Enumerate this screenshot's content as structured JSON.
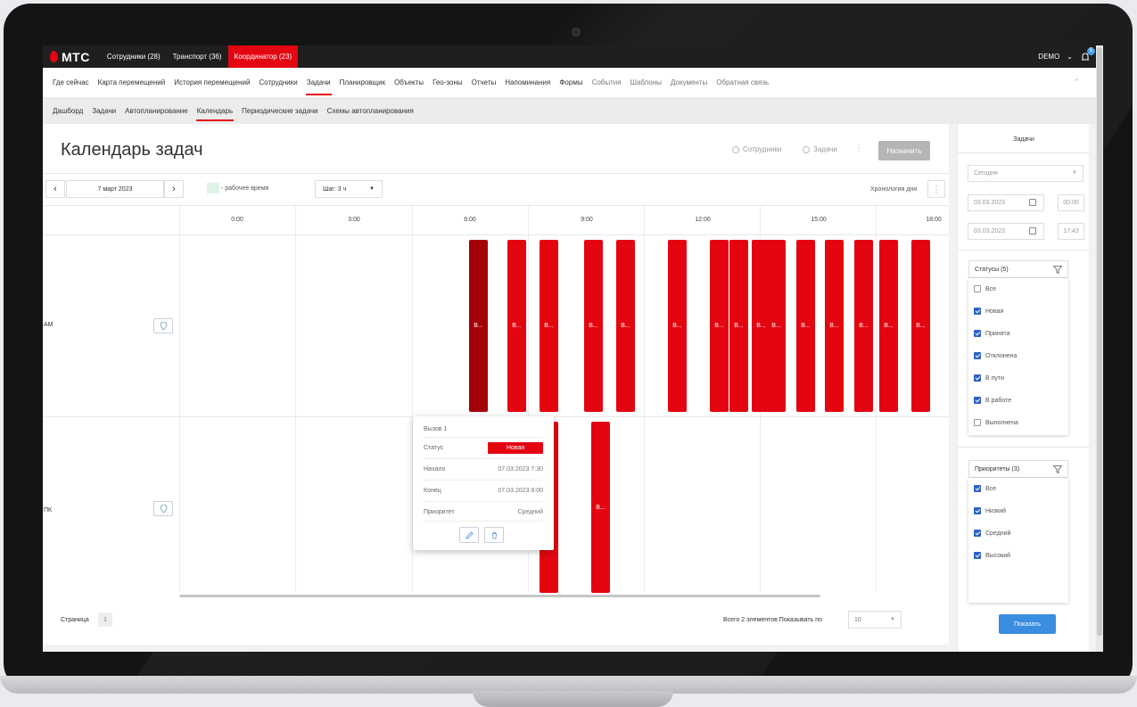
{
  "app": {
    "brand": "МТС",
    "top_tabs": [
      {
        "label": "Сотрудники (28)"
      },
      {
        "label": "Транспорт (36)"
      },
      {
        "label": "Координатор (23)"
      }
    ],
    "user": "DEMO",
    "notifications": "5"
  },
  "main_nav": [
    "Где сейчас",
    "Карта перемещений",
    "История перемещений",
    "Сотрудники",
    "Задачи",
    "Планировщик",
    "Объекты",
    "Гео-зоны",
    "Отчеты",
    "Напоминания",
    "Формы",
    "События",
    "Шаблоны",
    "Документы",
    "Обратная связь"
  ],
  "sub_nav": [
    "Дашборд",
    "Задачи",
    "Автопланирование",
    "Календарь",
    "Периодические задачи",
    "Схемы автопланирования"
  ],
  "page": {
    "title": "Календарь задач",
    "radio_employees": "Сотрудники",
    "radio_tasks": "Задачи",
    "assign_button": "Назначить",
    "date": "7 март 2023",
    "legend": "- рабочее время",
    "step": "Шаг: 3 ч",
    "chronology": "Хронология дня"
  },
  "timeline": {
    "hours": [
      "0:00",
      "3:00",
      "6:00",
      "9:00",
      "12:00",
      "15:00",
      "18:00"
    ],
    "rows": [
      {
        "label": "AM"
      },
      {
        "label": "ПК"
      }
    ],
    "task_label": "В..."
  },
  "tooltip": {
    "title": "Вызов 1",
    "status_key": "Статус",
    "status_value": "Новая",
    "start_key": "Начало",
    "start_value": "07.03.2023 7:30",
    "end_key": "Конец",
    "end_value": "07.03.2023 8:00",
    "priority_key": "Приоритет",
    "priority_value": "Средний"
  },
  "footer": {
    "page_label": "Страница",
    "page_number": "1",
    "total": "Всего 2 элементов Показывать по",
    "per_page": "10"
  },
  "filters": {
    "title": "Задачи",
    "period": "Сегодня",
    "date_from": "03.03.2023",
    "time_from": "00:00",
    "date_to": "03.03.2023",
    "time_to": "17:43",
    "statuses_label": "Статусы (5)",
    "statuses": [
      {
        "label": "Все",
        "checked": false
      },
      {
        "label": "Новая",
        "checked": true
      },
      {
        "label": "Принята",
        "checked": true
      },
      {
        "label": "Отклонена",
        "checked": true
      },
      {
        "label": "В пути",
        "checked": true
      },
      {
        "label": "В работе",
        "checked": true
      },
      {
        "label": "Выполнена",
        "checked": false
      }
    ],
    "priorities_label": "Приоритеты (3)",
    "priorities": [
      {
        "label": "Все",
        "checked": true
      },
      {
        "label": "Низкий",
        "checked": true
      },
      {
        "label": "Средний",
        "checked": true
      },
      {
        "label": "Высокий",
        "checked": true
      }
    ],
    "show_button": "Показать"
  },
  "colors": {
    "brand_red": "#e30611",
    "task_selected": "#a30008",
    "accent_blue": "#3a8ddf",
    "checkbox_blue": "#2d62c6"
  }
}
